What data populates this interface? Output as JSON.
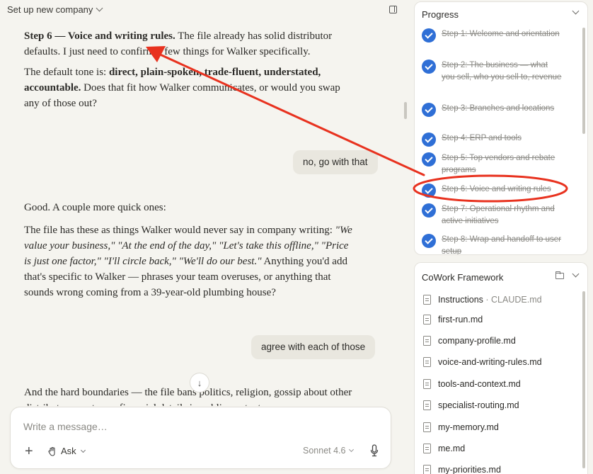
{
  "header": {
    "title": "Set up new company"
  },
  "chat": {
    "msg1": {
      "bold_lead": "Step 6 — Voice and writing rules.",
      "rest": " The file already has solid distributor defaults. I just need to confirm a few things for Walker specifically."
    },
    "msg2": {
      "lead": "The default tone is: ",
      "bold": "direct, plain-spoken, trade-fluent, understated, accountable.",
      "rest": " Does that fit how Walker communicates, or would you swap any of those out?"
    },
    "user1": "no, go with that",
    "msg3": "Good. A couple more quick ones:",
    "msg4": {
      "lead": "The file has these as things Walker would never say in company writing: ",
      "italic": "\"We value your business,\" \"At the end of the day,\" \"Let's take this offline,\" \"Price is just one factor,\" \"I'll circle back,\" \"We'll do our best.\"",
      "rest": " Anything you'd add that's specific to Walker — phrases your team overuses, or anything that sounds wrong coming from a 39-year-old plumbing house?"
    },
    "user2": "agree with each of those",
    "msg5": "And the hard boundaries — the file bans politics, religion, gossip about other distributors, customer financial details in public content..."
  },
  "composer": {
    "placeholder": "Write a message…",
    "mode": "Ask",
    "model": "Sonnet 4.6"
  },
  "progress": {
    "title": "Progress",
    "steps": [
      "Step 1: Welcome and orientation",
      "Step 2: The business — what you sell, who you sell to, revenue",
      "Step 3: Branches and locations",
      "Step 4: ERP and tools",
      "Step 5: Top vendors and rebate programs",
      "Step 6: Voice and writing rules",
      "Step 7: Operational rhythm and active initiatives",
      "Step 8: Wrap and handoff to user setup"
    ]
  },
  "cowork": {
    "title": "CoWork Framework",
    "files": [
      {
        "name": "Instructions",
        "sub": " · CLAUDE.md"
      },
      {
        "name": "first-run.md",
        "sub": ""
      },
      {
        "name": "company-profile.md",
        "sub": ""
      },
      {
        "name": "voice-and-writing-rules.md",
        "sub": ""
      },
      {
        "name": "tools-and-context.md",
        "sub": ""
      },
      {
        "name": "specialist-routing.md",
        "sub": ""
      },
      {
        "name": "my-memory.md",
        "sub": ""
      },
      {
        "name": "me.md",
        "sub": ""
      },
      {
        "name": "my-priorities.md",
        "sub": ""
      }
    ]
  },
  "colors": {
    "accent": "#2f6fd6",
    "annotation": "#e8321f",
    "background": "#f5f4ef"
  }
}
